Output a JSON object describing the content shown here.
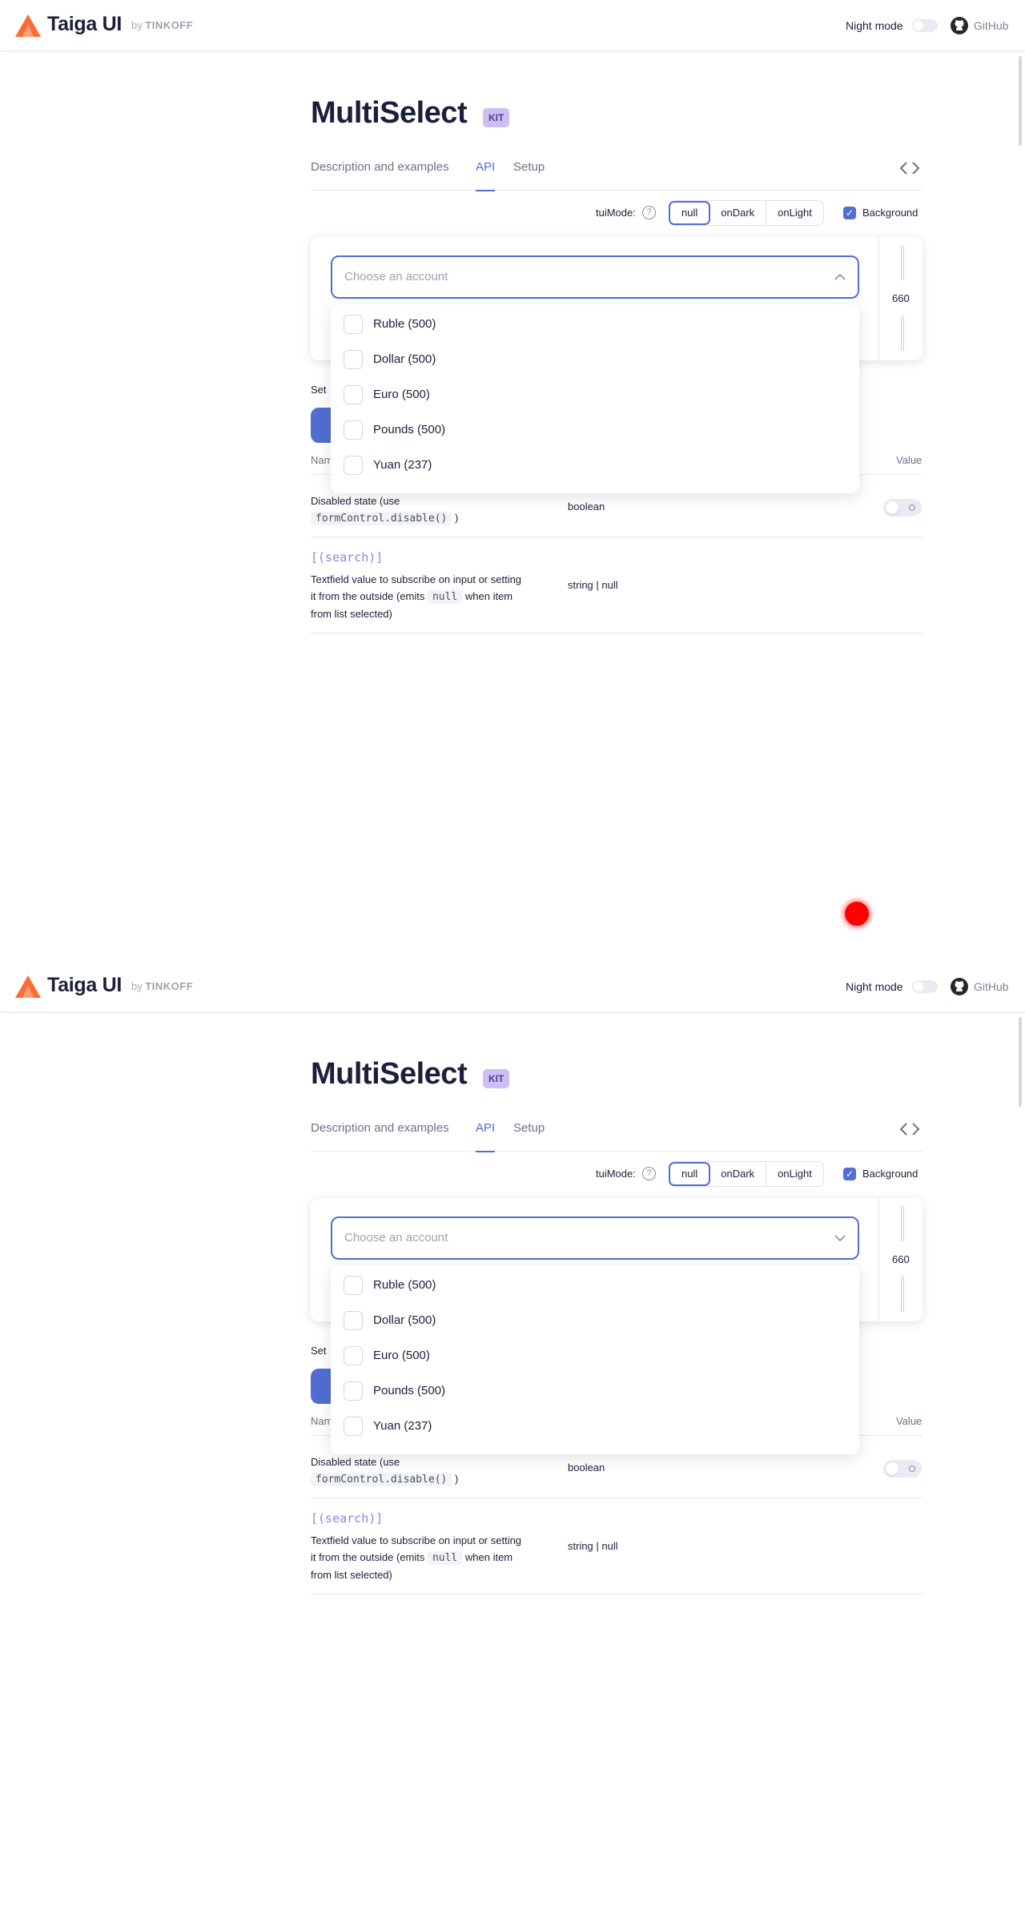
{
  "header": {
    "brand": "Taiga UI",
    "by_prefix": "by",
    "by_company": "TINKOFF",
    "night_mode_label": "Night mode",
    "github_label": "GitHub"
  },
  "page": {
    "title": "MultiSelect",
    "badge": "KIT",
    "tabs": [
      {
        "label": "Description and examples"
      },
      {
        "label": "API"
      },
      {
        "label": "Setup"
      }
    ]
  },
  "mode": {
    "label": "tuiMode:",
    "help": "?",
    "options": [
      "null",
      "onDark",
      "onLight"
    ],
    "selected": "null",
    "background_label": "Background",
    "background_checked": true
  },
  "demo": {
    "width_value": "660",
    "select_placeholder": "Choose an account",
    "options": [
      {
        "label": "Ruble (500)"
      },
      {
        "label": "Dollar (500)"
      },
      {
        "label": "Euro (500)"
      },
      {
        "label": "Pounds (500)"
      },
      {
        "label": "Yuan (237)"
      }
    ]
  },
  "api": {
    "set_label_fragment": "Set",
    "col_name": "Nam",
    "col_value": "Value",
    "rows": [
      {
        "desc_before": "Disabled state (use",
        "desc_code": "formControl.disable()",
        "desc_after": ")",
        "type": "boolean"
      },
      {
        "name": "[(search)]",
        "desc_line1": "Textfield value to subscribe on input or setting",
        "desc_line2_before": "it from the outside (emits",
        "desc_code": "null",
        "desc_line2_after": "when item",
        "desc_line3": "from list selected)",
        "type": "string | null"
      }
    ]
  },
  "colors": {
    "accent": "#526ed3",
    "logo": "#ff6b35",
    "badge_bg": "#cdbff3",
    "prop_name": "#9b7ddc",
    "marker": "#ff0000"
  }
}
